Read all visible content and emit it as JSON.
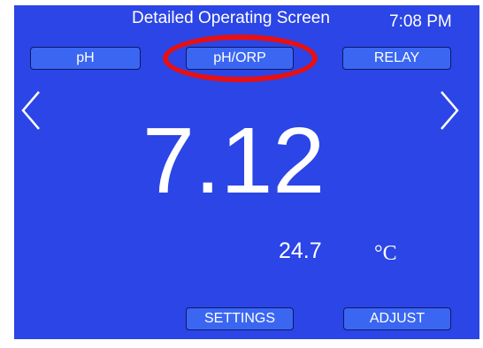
{
  "header": {
    "title": "Detailed Operating Screen",
    "time": "7:08 PM"
  },
  "tabs": [
    {
      "label": "pH"
    },
    {
      "label": "pH/ORP"
    },
    {
      "label": "RELAY"
    }
  ],
  "reading": {
    "value": "7.12"
  },
  "temperature": {
    "value": "24.7",
    "unit": "°C"
  },
  "buttons": {
    "settings": "SETTINGS",
    "adjust": "ADJUST"
  },
  "icons": {
    "prev": "chevron-left-icon",
    "next": "chevron-right-icon"
  },
  "colors": {
    "background": "#2b45e6",
    "button": "#3a66f2",
    "highlight": "#e81010"
  }
}
